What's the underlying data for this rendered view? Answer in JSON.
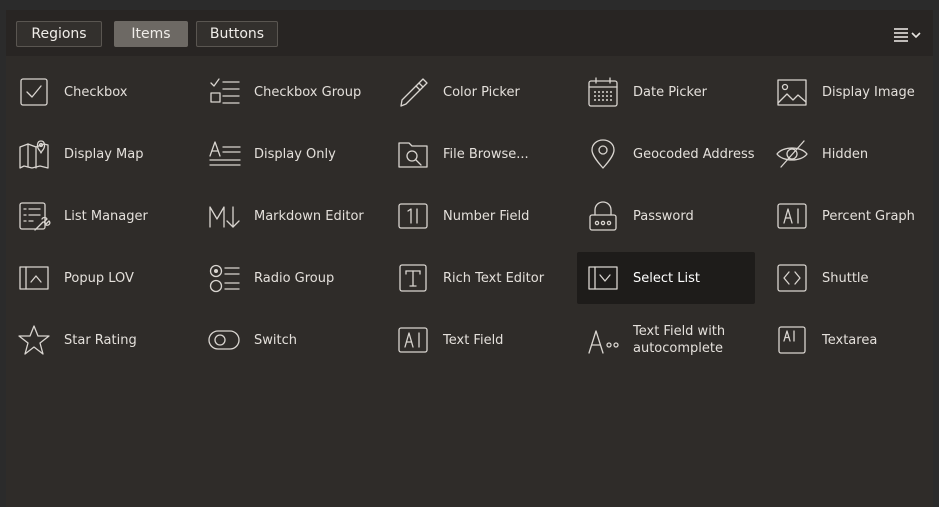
{
  "tabs": [
    {
      "label": "Regions",
      "active": false
    },
    {
      "label": "Items",
      "active": true
    },
    {
      "label": "Buttons",
      "active": false
    }
  ],
  "menu": {
    "icon": "hamburger-menu-icon",
    "chevron": "chevron-down-icon"
  },
  "items": [
    {
      "label": "Checkbox",
      "icon": "checkbox-icon"
    },
    {
      "label": "Checkbox Group",
      "icon": "checkbox-group-icon"
    },
    {
      "label": "Color Picker",
      "icon": "color-picker-icon"
    },
    {
      "label": "Date Picker",
      "icon": "date-picker-icon"
    },
    {
      "label": "Display Image",
      "icon": "display-image-icon"
    },
    {
      "label": "Display Map",
      "icon": "display-map-icon"
    },
    {
      "label": "Display Only",
      "icon": "display-only-icon"
    },
    {
      "label": "File Browse...",
      "icon": "file-browse-icon"
    },
    {
      "label": "Geocoded Address",
      "icon": "geocoded-address-icon"
    },
    {
      "label": "Hidden",
      "icon": "hidden-icon"
    },
    {
      "label": "List Manager",
      "icon": "list-manager-icon"
    },
    {
      "label": "Markdown Editor",
      "icon": "markdown-editor-icon"
    },
    {
      "label": "Number Field",
      "icon": "number-field-icon"
    },
    {
      "label": "Password",
      "icon": "password-icon"
    },
    {
      "label": "Percent Graph",
      "icon": "percent-graph-icon"
    },
    {
      "label": "Popup LOV",
      "icon": "popup-lov-icon"
    },
    {
      "label": "Radio Group",
      "icon": "radio-group-icon"
    },
    {
      "label": "Rich Text Editor",
      "icon": "rich-text-editor-icon"
    },
    {
      "label": "Select List",
      "icon": "select-list-icon",
      "selected": true
    },
    {
      "label": "Shuttle",
      "icon": "shuttle-icon"
    },
    {
      "label": "Star Rating",
      "icon": "star-rating-icon"
    },
    {
      "label": "Switch",
      "icon": "switch-icon"
    },
    {
      "label": "Text Field",
      "icon": "text-field-icon"
    },
    {
      "label": "Text Field with autocomplete",
      "icon": "text-field-autocomplete-icon"
    },
    {
      "label": "Textarea",
      "icon": "textarea-icon"
    }
  ],
  "colors": {
    "background": "#2f2c29",
    "toolbar": "#282523",
    "active_tab": "#6d6964",
    "selected_item": "#1e1c1a",
    "icon_stroke": "#d9d5d0"
  }
}
